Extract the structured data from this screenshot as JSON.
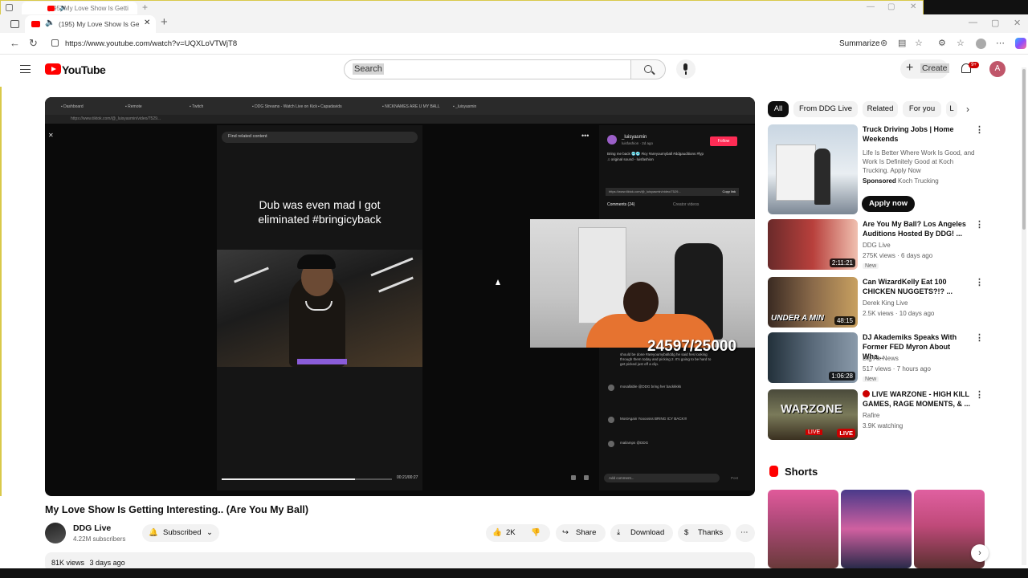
{
  "outer_window": {
    "tab_title": "(195) My Love Show Is Getti"
  },
  "browser": {
    "tab_title": "(195) My Love Show Is Getti",
    "url": "https://www.youtube.com/watch?v=UQXLoVTWjT8",
    "summarize_label": "Summarize"
  },
  "masthead": {
    "logo_text": "YouTube",
    "search_placeholder": "Search",
    "create_label": "Create",
    "notification_badge": "9+",
    "avatar_letter": "A"
  },
  "player": {
    "tiktok_search_placeholder": "Find related content",
    "caption_line1": "Dub was even mad I got",
    "caption_line2": "eliminated #bringicyback",
    "tiktok_time": "00:21/00:27",
    "tiktok_user": "_luisyasmin",
    "tiktok_user_sub": "luisfashion · 2d ago",
    "tiktok_follow": "Follow",
    "tiktok_desc": "Bring me back 🥶🥶 #icy #areyoumyball #ddgauditions #fyp",
    "tiktok_sound": "♫ original sound - luisfashion",
    "tiktok_link": "https://www.tiktok.com/@_luisyasmin/video/7529...",
    "tiktok_copy": "Copy link",
    "comments_tab": "Comments (24)",
    "creator_tab": "Creator videos",
    "counter": "24597/25000",
    "comments": [
      "should be done #areyoumyballddg he said hes looking through them today and picking 2. It's going to be hard to get picked just off a clip.",
      "mosallable @DDG bring her backkkkk",
      "MostAgain Yoooosss BRING ICY BACK!!!",
      "mailamps @DDG"
    ],
    "add_comment": "Add comment...",
    "post": "Post"
  },
  "video": {
    "title": "My Love Show Is Getting Interesting.. (Are You My Ball)",
    "channel": "DDG Live",
    "subscribers": "4.22M subscribers",
    "subscribed_label": "Subscribed",
    "likes": "2K",
    "share_label": "Share",
    "download_label": "Download",
    "thanks_label": "Thanks",
    "views": "81K views",
    "date": "3 days ago"
  },
  "chips": [
    "All",
    "From DDG Live",
    "Related",
    "For you",
    "L"
  ],
  "recommendations": [
    {
      "title": "Truck Driving Jobs | Home Weekends",
      "desc": "Life Is Better Where Work Is Good, and Work Is Definitely Good at Koch Trucking. Apply Now",
      "sponsored": "Sponsored",
      "advertiser": "Koch Trucking",
      "cta": "Apply now"
    },
    {
      "title": "Are You My Ball? Los Angeles Auditions Hosted By DDG! ...",
      "channel": "DDG Live",
      "meta": "275K views · 6 days ago",
      "badge": "New",
      "duration": "2:11:21"
    },
    {
      "title": "Can WizardKelly Eat 100 CHICKEN NUGGETS?!? ...",
      "channel": "Derek King Live",
      "meta": "2.5K views · 10 days ago",
      "duration": "48:15",
      "thumb_text": "UNDER A MIN"
    },
    {
      "title": "DJ Akademiks Speaks With Former FED Myron About Wha...",
      "channel": "Big Ak News",
      "meta": "517 views · 7 hours ago",
      "badge": "New",
      "duration": "1:06:28"
    },
    {
      "title": "LIVE WARZONE - HIGH KILL GAMES, RAGE MOMENTS, & ...",
      "channel": "Rafire",
      "meta": "3.9K watching",
      "badge": "LIVE",
      "thumb_text": "WARZONE",
      "thumb_live": "LIVE"
    }
  ],
  "shorts": {
    "title": "Shorts"
  },
  "colors": {
    "accent": "#ff0000",
    "follow": "#fe2c55",
    "streamer_shirt": "#e67330"
  }
}
